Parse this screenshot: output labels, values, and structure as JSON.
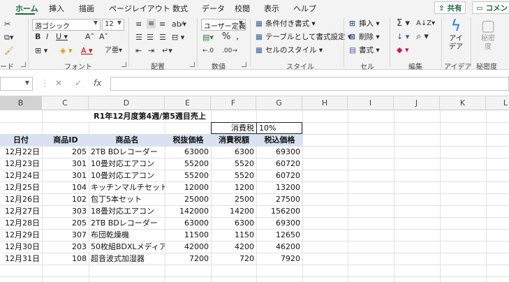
{
  "tabs": [
    "ホーム",
    "挿入",
    "描画",
    "ページレイアウト",
    "数式",
    "データ",
    "校閲",
    "表示",
    "ヘルプ"
  ],
  "share_label": "共有",
  "comment_label": "コメント",
  "ribbon": {
    "font_name": "游ゴシック",
    "font_size": "12",
    "number_format": "ユーザー定義",
    "styles": {
      "conditional": "条件付き書式",
      "table": "テーブルとして書式設定",
      "cell_styles": "セルのスタイル"
    },
    "cells_cmds": {
      "insert": "挿入",
      "delete": "削除",
      "format": "書式"
    },
    "ideas_label": "アイ\nデア",
    "sensitivity_label": "秘密\n度",
    "groups": {
      "clipboard": "ード",
      "font": "フォント",
      "alignment": "配置",
      "number": "数値",
      "styles": "スタイル",
      "cells": "セル",
      "editing": "編集",
      "ideas": "アイデア",
      "sensitivity": "秘密度"
    }
  },
  "formula_bar": {
    "name_box": "",
    "formula": ""
  },
  "columns": [
    "B",
    "C",
    "D",
    "E",
    "F",
    "G",
    "H",
    "I",
    "J",
    "K",
    "L"
  ],
  "sheet": {
    "title": "R1年12月度第4週/第5週目売上",
    "tax_label": "消費税",
    "tax_rate": "10%",
    "headers": [
      "日付",
      "商品ID",
      "商品名",
      "税抜価格",
      "消費税額",
      "税込価格"
    ],
    "rows": [
      [
        "12月22日",
        "205",
        "2TB BDレコーダー",
        "63000",
        "6300",
        "69300"
      ],
      [
        "12月23日",
        "301",
        "10畳対応エアコン",
        "55200",
        "5520",
        "60720"
      ],
      [
        "12月24日",
        "301",
        "10畳対応エアコン",
        "55200",
        "5520",
        "60720"
      ],
      [
        "12月25日",
        "104",
        "キッチンマルチセット",
        "12000",
        "1200",
        "13200"
      ],
      [
        "12月26日",
        "102",
        "包丁5本セット",
        "25000",
        "2500",
        "27500"
      ],
      [
        "12月27日",
        "303",
        "18畳対応エアコン",
        "142000",
        "14200",
        "156200"
      ],
      [
        "12月28日",
        "205",
        "2TB BDレコーダー",
        "63000",
        "6300",
        "69300"
      ],
      [
        "12月29日",
        "307",
        "布団乾燥機",
        "11500",
        "1150",
        "12650"
      ],
      [
        "12月30日",
        "203",
        "50枚組BDXLメディア",
        "42000",
        "4200",
        "46200"
      ],
      [
        "12月31日",
        "108",
        "超音波式加湿器",
        "7200",
        "720",
        "7920"
      ]
    ]
  }
}
